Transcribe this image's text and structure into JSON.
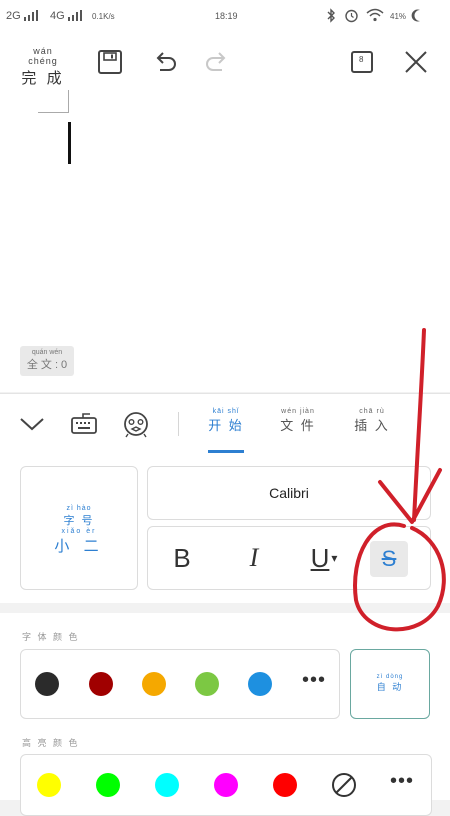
{
  "status_bar": {
    "network_1": "2G",
    "network_2": "4G",
    "speed": "0.1K/s",
    "time": "18:19",
    "battery": "41%",
    "icons": [
      "signal-icon",
      "bluetooth-icon",
      "alarm-icon",
      "wifi-icon",
      "battery-icon"
    ]
  },
  "toolbar": {
    "done_pinyin": "wán chéng",
    "done_label": "完 成",
    "icons": [
      "save-icon",
      "undo-icon",
      "redo-icon",
      "page-count-icon",
      "close-icon"
    ],
    "page_count": "8"
  },
  "document": {
    "word_count_pinyin": "quán wén",
    "word_count_label": "全 文 : 0"
  },
  "tab_bar": {
    "icons": [
      "collapse-chevron-icon",
      "keyboard-icon",
      "face-icon"
    ],
    "tabs": [
      {
        "pinyin": "kāi shǐ",
        "label": "开 始",
        "active": true
      },
      {
        "pinyin": "wén jiàn",
        "label": "文 件",
        "active": false
      },
      {
        "pinyin": "chā rù",
        "label": "插 入",
        "active": false
      }
    ]
  },
  "format_panel": {
    "style_card": {
      "line1_pinyin": "zì hào",
      "line1_label": "字 号",
      "line2_pinyin": "xiǎo èr",
      "line2_label": "小 二"
    },
    "font_name": "Calibri",
    "format_buttons": {
      "bold": "B",
      "italic": "I",
      "underline": "U",
      "strikethrough": "S"
    },
    "font_color_label": "字 体 颜 色",
    "font_colors": [
      "#2b2b2b",
      "#a00000",
      "#f5a800",
      "#7cc843",
      "#1e90e0"
    ],
    "auto_card": {
      "pinyin": "zì dòng",
      "label": "自 动"
    },
    "highlight_label": "高 亮 颜 色",
    "highlight_colors": [
      "#ffff00",
      "#00ff00",
      "#00ffff",
      "#ff00ff",
      "#ff0000"
    ],
    "accent_color": "#2d7fd1",
    "annotation_color": "#d0202a"
  }
}
